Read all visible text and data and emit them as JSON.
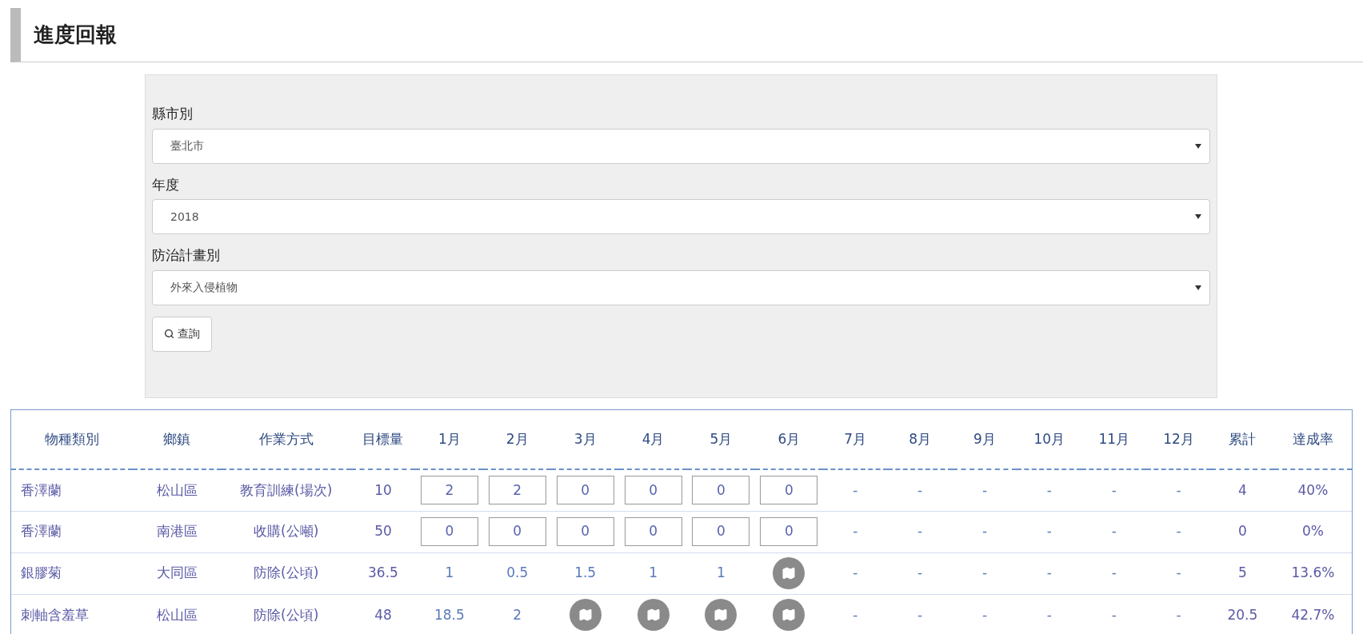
{
  "page_title": "進度回報",
  "filters": [
    {
      "label": "縣市別",
      "value": "臺北市"
    },
    {
      "label": "年度",
      "value": "2018"
    },
    {
      "label": "防治計畫別",
      "value": "外來入侵植物"
    }
  ],
  "search_button": "查詢",
  "table": {
    "columns": [
      "物種類別",
      "鄉鎮",
      "作業方式",
      "目標量",
      "1月",
      "2月",
      "3月",
      "4月",
      "5月",
      "6月",
      "7月",
      "8月",
      "9月",
      "10月",
      "11月",
      "12月",
      "累計",
      "達成率"
    ],
    "rows": [
      {
        "species": "香澤蘭",
        "town": "松山區",
        "method": "教育訓練(場次)",
        "target": "10",
        "months": [
          {
            "kind": "input",
            "value": "2"
          },
          {
            "kind": "input",
            "value": "2"
          },
          {
            "kind": "input",
            "value": "0"
          },
          {
            "kind": "input",
            "value": "0"
          },
          {
            "kind": "input",
            "value": "0"
          },
          {
            "kind": "input",
            "value": "0"
          },
          {
            "kind": "text",
            "value": "-"
          },
          {
            "kind": "text",
            "value": "-"
          },
          {
            "kind": "text",
            "value": "-"
          },
          {
            "kind": "text",
            "value": "-"
          },
          {
            "kind": "text",
            "value": "-"
          },
          {
            "kind": "text",
            "value": "-"
          }
        ],
        "total": "4",
        "rate": "40%"
      },
      {
        "species": "香澤蘭",
        "town": "南港區",
        "method": "收購(公噸)",
        "target": "50",
        "months": [
          {
            "kind": "input",
            "value": "0"
          },
          {
            "kind": "input",
            "value": "0"
          },
          {
            "kind": "input",
            "value": "0"
          },
          {
            "kind": "input",
            "value": "0"
          },
          {
            "kind": "input",
            "value": "0"
          },
          {
            "kind": "input",
            "value": "0"
          },
          {
            "kind": "text",
            "value": "-"
          },
          {
            "kind": "text",
            "value": "-"
          },
          {
            "kind": "text",
            "value": "-"
          },
          {
            "kind": "text",
            "value": "-"
          },
          {
            "kind": "text",
            "value": "-"
          },
          {
            "kind": "text",
            "value": "-"
          }
        ],
        "total": "0",
        "rate": "0%"
      },
      {
        "species": "銀膠菊",
        "town": "大同區",
        "method": "防除(公頃)",
        "target": "36.5",
        "months": [
          {
            "kind": "text",
            "value": "1"
          },
          {
            "kind": "text",
            "value": "0.5"
          },
          {
            "kind": "text",
            "value": "1.5"
          },
          {
            "kind": "text",
            "value": "1"
          },
          {
            "kind": "text",
            "value": "1"
          },
          {
            "kind": "map"
          },
          {
            "kind": "text",
            "value": "-"
          },
          {
            "kind": "text",
            "value": "-"
          },
          {
            "kind": "text",
            "value": "-"
          },
          {
            "kind": "text",
            "value": "-"
          },
          {
            "kind": "text",
            "value": "-"
          },
          {
            "kind": "text",
            "value": "-"
          }
        ],
        "total": "5",
        "rate": "13.6%"
      },
      {
        "species": "刺軸含羞草",
        "town": "松山區",
        "method": "防除(公頃)",
        "target": "48",
        "months": [
          {
            "kind": "text",
            "value": "18.5"
          },
          {
            "kind": "text",
            "value": "2"
          },
          {
            "kind": "map"
          },
          {
            "kind": "map"
          },
          {
            "kind": "map"
          },
          {
            "kind": "map"
          },
          {
            "kind": "text",
            "value": "-"
          },
          {
            "kind": "text",
            "value": "-"
          },
          {
            "kind": "text",
            "value": "-"
          },
          {
            "kind": "text",
            "value": "-"
          },
          {
            "kind": "text",
            "value": "-"
          },
          {
            "kind": "text",
            "value": "-"
          }
        ],
        "total": "20.5",
        "rate": "42.7%"
      }
    ]
  }
}
